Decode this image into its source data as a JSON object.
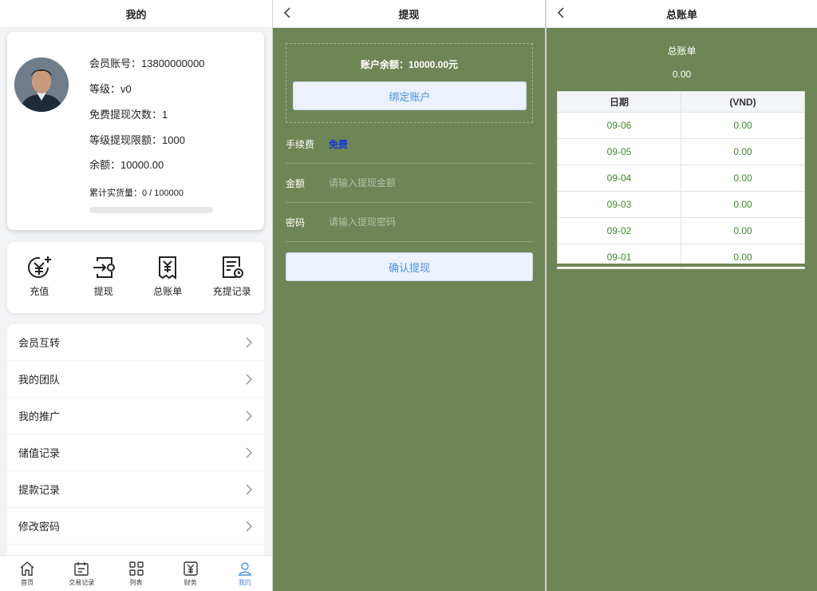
{
  "colors": {
    "accent": "#4a90e2",
    "panel_bg": "#6e8655",
    "fee_blue": "#1833e6",
    "value_green": "#3d8b2a"
  },
  "profile": {
    "title": "我的",
    "avatar_icon": "avatar-photo",
    "lines": [
      "会员账号：13800000000",
      "等级：v0",
      "免费提现次数：1",
      "等级提现限额：1000",
      "余额：10000.00"
    ],
    "sales_text": "累计实货量：0 / 100000",
    "sales_progress": 0,
    "actions": [
      {
        "label": "充值",
        "icon": "recharge-icon"
      },
      {
        "label": "提现",
        "icon": "withdraw-icon"
      },
      {
        "label": "总账单",
        "icon": "bill-icon"
      },
      {
        "label": "充提记录",
        "icon": "records-icon"
      }
    ],
    "menu": [
      "会员互转",
      "我的团队",
      "我的推广",
      "储值记录",
      "提款记录",
      "修改密码"
    ],
    "tabs": [
      {
        "label": "首页",
        "icon": "home-icon",
        "active": false
      },
      {
        "label": "交易记录",
        "icon": "transactions-icon",
        "active": false
      },
      {
        "label": "列表",
        "icon": "grid-icon",
        "active": false
      },
      {
        "label": "财务",
        "icon": "finance-icon",
        "active": false
      },
      {
        "label": "我的",
        "icon": "user-icon",
        "active": true
      }
    ]
  },
  "withdraw": {
    "title": "提现",
    "balance": "账户余额：10000.00元",
    "bind_button": "绑定账户",
    "fee_label": "手续费",
    "fee_value": "免费",
    "amount_label": "金额",
    "amount_placeholder": "请输入提现金额",
    "amount_value": "",
    "password_label": "密码",
    "password_placeholder": "请输入提现密码",
    "password_value": "",
    "confirm_button": "确认提现"
  },
  "bill": {
    "title": "总账单",
    "heading": "总账单",
    "total": "0.00",
    "columns": [
      "日期",
      "(VND)"
    ],
    "rows": [
      [
        "09-06",
        "0.00"
      ],
      [
        "09-05",
        "0.00"
      ],
      [
        "09-04",
        "0.00"
      ],
      [
        "09-03",
        "0.00"
      ],
      [
        "09-02",
        "0.00"
      ],
      [
        "09-01",
        "0.00"
      ]
    ]
  }
}
